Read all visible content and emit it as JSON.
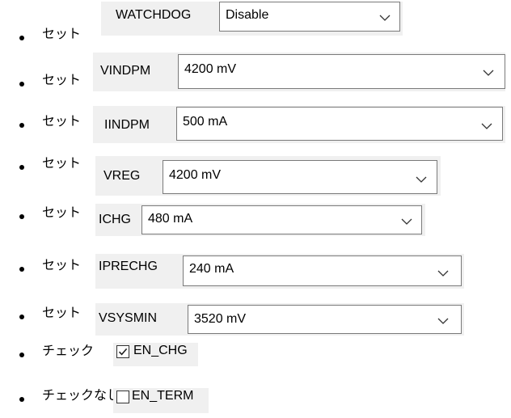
{
  "settings": [
    {
      "action": "セット",
      "label": "WATCHDOG",
      "value": "Disable"
    },
    {
      "action": "セット",
      "label": "VINDPM",
      "value": "4200 mV"
    },
    {
      "action": "セット",
      "label": "IINDPM",
      "value": "500 mA"
    },
    {
      "action": "セット",
      "label": "VREG",
      "value": "4200 mV"
    },
    {
      "action": "セット",
      "label": "ICHG",
      "value": "480 mA"
    },
    {
      "action": "セット",
      "label": "IPRECHG",
      "value": "240 mA"
    },
    {
      "action": "セット",
      "label": "VSYSMIN",
      "value": "3520 mV"
    }
  ],
  "checks": [
    {
      "action": "チェック",
      "label": "EN_CHG",
      "checked": true
    },
    {
      "action": "チェックなし",
      "label": "EN_TERM",
      "checked": false
    }
  ],
  "icons": {
    "dropdown": "chevron-down-icon",
    "checkbox_checked": "checkmark-icon"
  },
  "colors": {
    "control_bg": "#f0f0f0",
    "combo_border": "#7a7a7a"
  }
}
